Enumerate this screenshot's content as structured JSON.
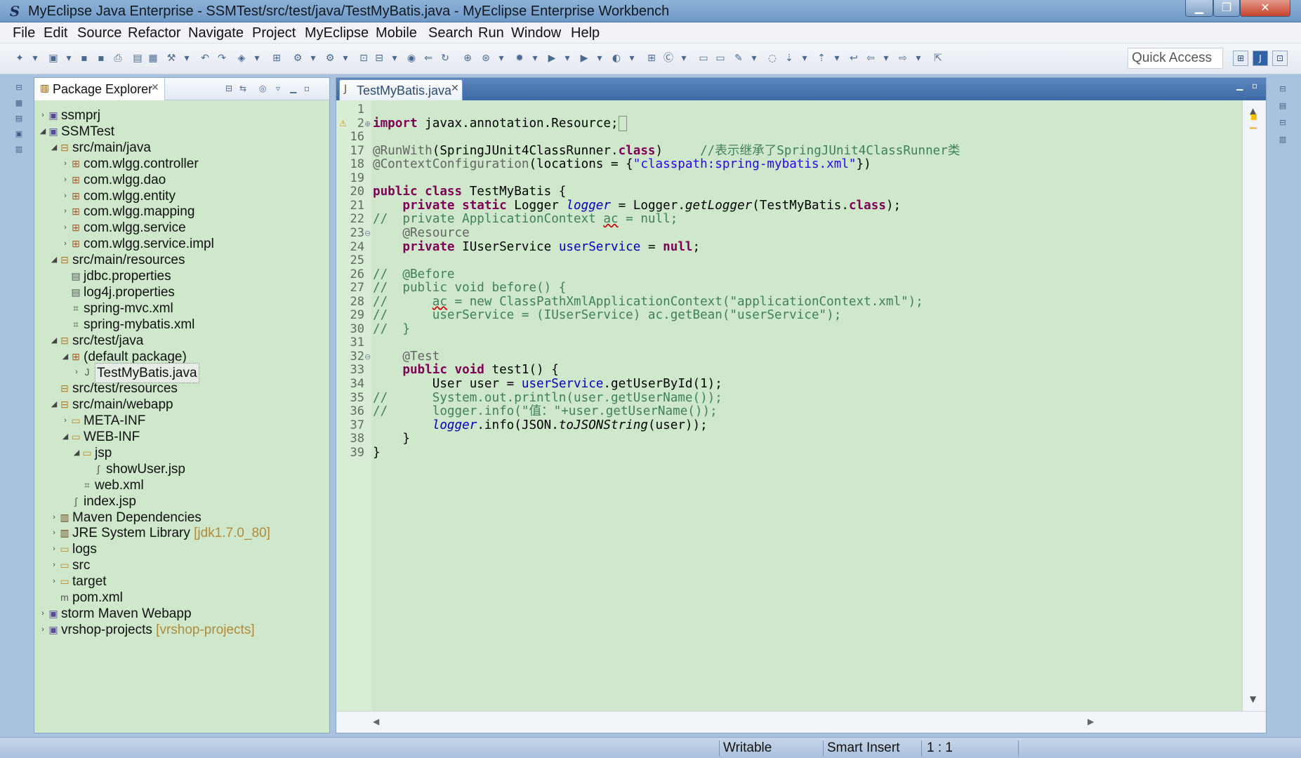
{
  "window": {
    "title": "MyEclipse Java Enterprise - SSMTest/src/test/java/TestMyBatis.java - MyEclipse Enterprise Workbench",
    "icon": "myeclipse-logo-icon"
  },
  "menu": [
    "File",
    "Edit",
    "Source",
    "Refactor",
    "Navigate",
    "Project",
    "MyEclipse",
    "Mobile",
    "Search",
    "Run",
    "Window",
    "Help"
  ],
  "toolbar": {
    "quick_access": "Quick Access"
  },
  "explorer": {
    "tab_label": "Package Explorer",
    "items": [
      {
        "label": "ssmprj",
        "depth": 0,
        "twisty": "›",
        "icon": "project-icon"
      },
      {
        "label": "SSMTest",
        "depth": 0,
        "twisty": "◢",
        "icon": "project-icon"
      },
      {
        "label": "src/main/java",
        "depth": 1,
        "twisty": "◢",
        "icon": "source-folder-icon"
      },
      {
        "label": "com.wlgg.controller",
        "depth": 2,
        "twisty": "›",
        "icon": "package-icon"
      },
      {
        "label": "com.wlgg.dao",
        "depth": 2,
        "twisty": "›",
        "icon": "package-icon"
      },
      {
        "label": "com.wlgg.entity",
        "depth": 2,
        "twisty": "›",
        "icon": "package-icon"
      },
      {
        "label": "com.wlgg.mapping",
        "depth": 2,
        "twisty": "›",
        "icon": "package-icon"
      },
      {
        "label": "com.wlgg.service",
        "depth": 2,
        "twisty": "›",
        "icon": "package-icon"
      },
      {
        "label": "com.wlgg.service.impl",
        "depth": 2,
        "twisty": "›",
        "icon": "package-icon"
      },
      {
        "label": "src/main/resources",
        "depth": 1,
        "twisty": "◢",
        "icon": "source-folder-icon"
      },
      {
        "label": "jdbc.properties",
        "depth": 2,
        "twisty": "",
        "icon": "properties-file-icon"
      },
      {
        "label": "log4j.properties",
        "depth": 2,
        "twisty": "",
        "icon": "properties-file-icon"
      },
      {
        "label": "spring-mvc.xml",
        "depth": 2,
        "twisty": "",
        "icon": "xml-file-icon"
      },
      {
        "label": "spring-mybatis.xml",
        "depth": 2,
        "twisty": "",
        "icon": "xml-file-icon"
      },
      {
        "label": "src/test/java",
        "depth": 1,
        "twisty": "◢",
        "icon": "source-folder-icon"
      },
      {
        "label": "(default package)",
        "depth": 2,
        "twisty": "◢",
        "icon": "package-icon"
      },
      {
        "label": "TestMyBatis.java",
        "depth": 3,
        "twisty": "›",
        "icon": "java-file-icon",
        "selected": true
      },
      {
        "label": "src/test/resources",
        "depth": 1,
        "twisty": "",
        "icon": "source-folder-icon"
      },
      {
        "label": "src/main/webapp",
        "depth": 1,
        "twisty": "◢",
        "icon": "source-folder-icon"
      },
      {
        "label": "META-INF",
        "depth": 2,
        "twisty": "›",
        "icon": "folder-icon"
      },
      {
        "label": "WEB-INF",
        "depth": 2,
        "twisty": "◢",
        "icon": "folder-icon"
      },
      {
        "label": "jsp",
        "depth": 3,
        "twisty": "◢",
        "icon": "folder-icon"
      },
      {
        "label": "showUser.jsp",
        "depth": 4,
        "twisty": "",
        "icon": "jsp-file-icon"
      },
      {
        "label": "web.xml",
        "depth": 3,
        "twisty": "",
        "icon": "xml-file-icon"
      },
      {
        "label": "index.jsp",
        "depth": 2,
        "twisty": "",
        "icon": "jsp-file-icon"
      },
      {
        "label": "Maven Dependencies",
        "depth": 1,
        "twisty": "›",
        "icon": "library-icon"
      },
      {
        "label": "JRE System Library",
        "decoration": "[jdk1.7.0_80]",
        "depth": 1,
        "twisty": "›",
        "icon": "library-icon"
      },
      {
        "label": "logs",
        "depth": 1,
        "twisty": "›",
        "icon": "folder-icon"
      },
      {
        "label": "src",
        "depth": 1,
        "twisty": "›",
        "icon": "folder-icon"
      },
      {
        "label": "target",
        "depth": 1,
        "twisty": "›",
        "icon": "folder-icon"
      },
      {
        "label": "pom.xml",
        "depth": 1,
        "twisty": "",
        "icon": "maven-pom-icon"
      },
      {
        "label": "storm Maven Webapp",
        "depth": 0,
        "twisty": "›",
        "icon": "project-icon"
      },
      {
        "label": "vrshop-projects",
        "decoration": "[vrshop-projects]",
        "depth": 0,
        "twisty": "›",
        "icon": "project-icon"
      }
    ]
  },
  "editor": {
    "tab_label": "TestMyBatis.java",
    "lines": [
      {
        "n": "1",
        "html": ""
      },
      {
        "n": "2",
        "fold": "⊕",
        "marker": true,
        "html": "<span class=\"k\">import</span> javax.annotation.Resource;<span style=\"border:1px solid #888;\">&nbsp;</span>"
      },
      {
        "n": "16",
        "html": ""
      },
      {
        "n": "17",
        "html": "<span class=\"a\">@RunWith</span>(SpringJUnit4ClassRunner.<span class=\"k\">class</span>)     <span class=\"c\">//表示继承了SpringJUnit4ClassRunner类</span>"
      },
      {
        "n": "18",
        "html": "<span class=\"a\">@ContextConfiguration</span>(locations = {<span class=\"s\">\"classpath:spring-mybatis.xml\"</span>})"
      },
      {
        "n": "19",
        "html": ""
      },
      {
        "n": "20",
        "html": "<span class=\"k\">public class</span> TestMyBatis {"
      },
      {
        "n": "21",
        "html": "    <span class=\"k\">private static</span> Logger <span class=\"sf\">logger</span> = Logger.<span class=\"it\">getLogger</span>(TestMyBatis.<span class=\"k\">class</span>);"
      },
      {
        "n": "22",
        "html": "<span class=\"c\">//  private ApplicationContext <u style=\"text-decoration:underline wavy #c00;\">ac</u> = null;</span>"
      },
      {
        "n": "23",
        "fold": "⊖",
        "html": "    <span class=\"a\">@Resource</span>"
      },
      {
        "n": "24",
        "html": "    <span class=\"k\">private</span> IUserService <span class=\"f\">userService</span> = <span class=\"k\">null</span>;"
      },
      {
        "n": "25",
        "html": ""
      },
      {
        "n": "26",
        "html": "<span class=\"c\">//  @Before</span>"
      },
      {
        "n": "27",
        "html": "<span class=\"c\">//  public void before() {</span>"
      },
      {
        "n": "28",
        "html": "<span class=\"c\">//      <u style=\"text-decoration:underline wavy #c00;\">ac</u> = new ClassPathXmlApplicationContext(\"applicationContext.xml\");</span>"
      },
      {
        "n": "29",
        "html": "<span class=\"c\">//      userService = (IUserService) ac.getBean(\"userService\");</span>"
      },
      {
        "n": "30",
        "html": "<span class=\"c\">//  }</span>"
      },
      {
        "n": "31",
        "html": ""
      },
      {
        "n": "32",
        "fold": "⊖",
        "html": "    <span class=\"a\">@Test</span>"
      },
      {
        "n": "33",
        "html": "    <span class=\"k\">public void</span> test1() {"
      },
      {
        "n": "34",
        "html": "        User user = <span class=\"f\">userService</span>.getUserById(1);"
      },
      {
        "n": "35",
        "html": "<span class=\"c\">//      System.out.println(user.getUserName());</span>"
      },
      {
        "n": "36",
        "html": "<span class=\"c\">//      logger.info(\"值：\"+user.getUserName());</span>"
      },
      {
        "n": "37",
        "html": "        <span class=\"sf\">logger</span>.info(JSON.<span class=\"it\">toJSONString</span>(user));"
      },
      {
        "n": "38",
        "html": "    }"
      },
      {
        "n": "39",
        "html": "}"
      }
    ]
  },
  "status": {
    "writable": "Writable",
    "insert_mode": "Smart Insert",
    "position": "1 : 1"
  }
}
